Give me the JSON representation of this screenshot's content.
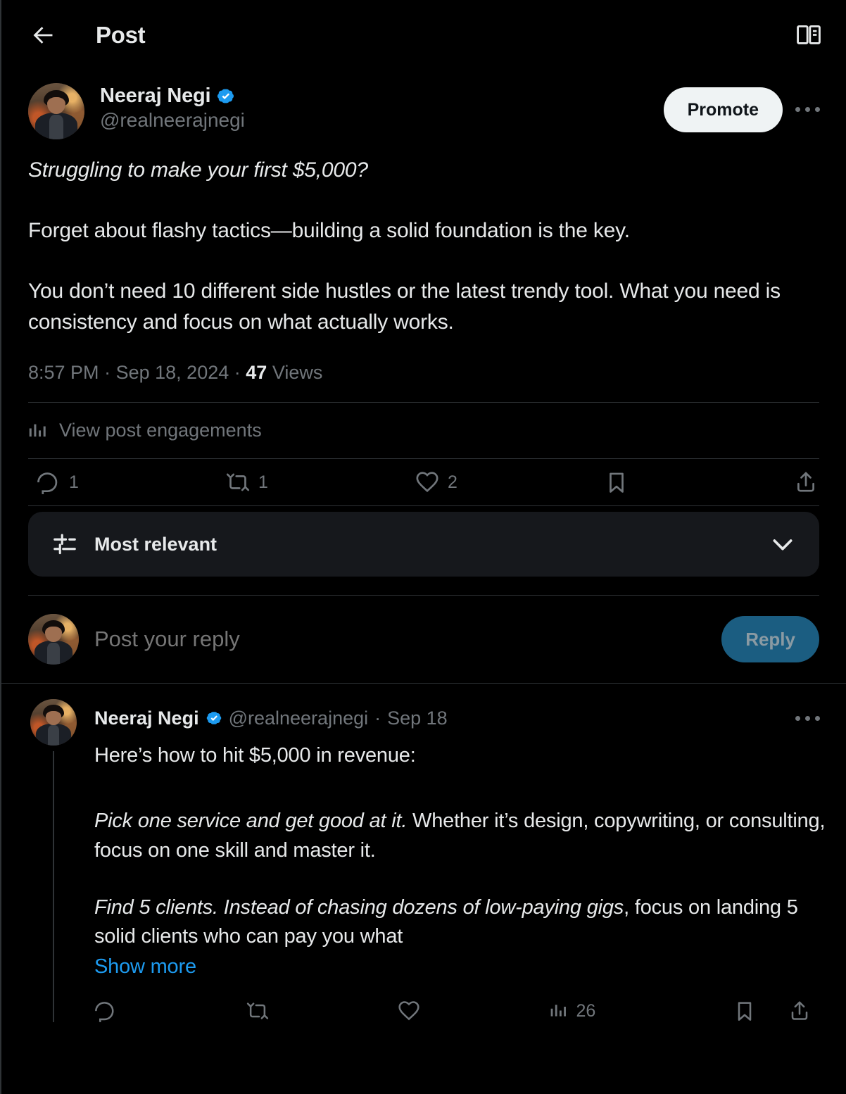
{
  "header": {
    "back_icon": "arrow-left-icon",
    "title": "Post",
    "reader_icon": "reader-mode-icon"
  },
  "post": {
    "author": {
      "display_name": "Neeraj Negi",
      "handle": "@realneerajnegi",
      "verified": true,
      "verified_color": "#1d9bf0",
      "avatar_alt": "profile-photo"
    },
    "promote_label": "Promote",
    "more_icon": "more-options-icon",
    "paragraphs": [
      {
        "text": "Struggling to make your first $5,000?",
        "italic": true
      },
      {
        "text": "Forget about flashy tactics—building a solid foundation is the key.",
        "italic": false
      },
      {
        "text": "You don’t need 10 different side hustles or the latest trendy tool. What you need is consistency and focus on what actually works.",
        "italic": false
      }
    ],
    "meta": {
      "time": "8:57 PM",
      "dot": "·",
      "date": "Sep 18, 2024",
      "views_count": "47",
      "views_label": "Views"
    },
    "engagements_label": "View post engagements",
    "engagements_icon": "bar-chart-icon",
    "actions": [
      {
        "name": "reply",
        "icon": "reply-icon",
        "count": "1"
      },
      {
        "name": "repost",
        "icon": "repost-icon",
        "count": "1"
      },
      {
        "name": "like",
        "icon": "heart-icon",
        "count": "2"
      },
      {
        "name": "bookmark",
        "icon": "bookmark-icon",
        "count": ""
      },
      {
        "name": "share",
        "icon": "share-icon",
        "count": ""
      }
    ]
  },
  "sort": {
    "icon": "sliders-icon",
    "label": "Most relevant",
    "chevron_icon": "chevron-down-icon"
  },
  "composer": {
    "placeholder": "Post your reply",
    "value": "",
    "reply_label": "Reply"
  },
  "reply": {
    "author": {
      "display_name": "Neeraj Negi",
      "handle": "@realneerajnegi",
      "verified": true
    },
    "separator": "·",
    "date": "Sep 18",
    "more_icon": "more-options-icon",
    "lead_text": "Here’s how to hit $5,000 in revenue:",
    "blocks": [
      {
        "italic_part": "Pick one service and get good at it.",
        "rest_part": " Whether it’s design, copywriting, or consulting, focus on one skill and master it."
      },
      {
        "italic_part": "Find 5 clients. Instead of chasing dozens of low-paying gigs",
        "rest_part": ", focus on landing 5 solid clients who can pay you what"
      }
    ],
    "show_more_label": "Show more",
    "show_more_color": "#1d9bf0",
    "actions": [
      {
        "name": "reply",
        "icon": "reply-icon",
        "count": ""
      },
      {
        "name": "repost",
        "icon": "repost-icon",
        "count": ""
      },
      {
        "name": "like",
        "icon": "heart-icon",
        "count": ""
      },
      {
        "name": "views",
        "icon": "bar-chart-icon",
        "count": "26"
      },
      {
        "name": "bookmark",
        "icon": "bookmark-icon",
        "count": ""
      },
      {
        "name": "share",
        "icon": "share-icon",
        "count": ""
      }
    ]
  },
  "theme": {
    "background": "#000000",
    "text_primary": "#e7e9ea",
    "text_secondary": "#71767b",
    "border": "#2f3336",
    "accent": "#1d9bf0",
    "pill_bg": "#16181c",
    "promote_bg": "#eff3f4"
  }
}
